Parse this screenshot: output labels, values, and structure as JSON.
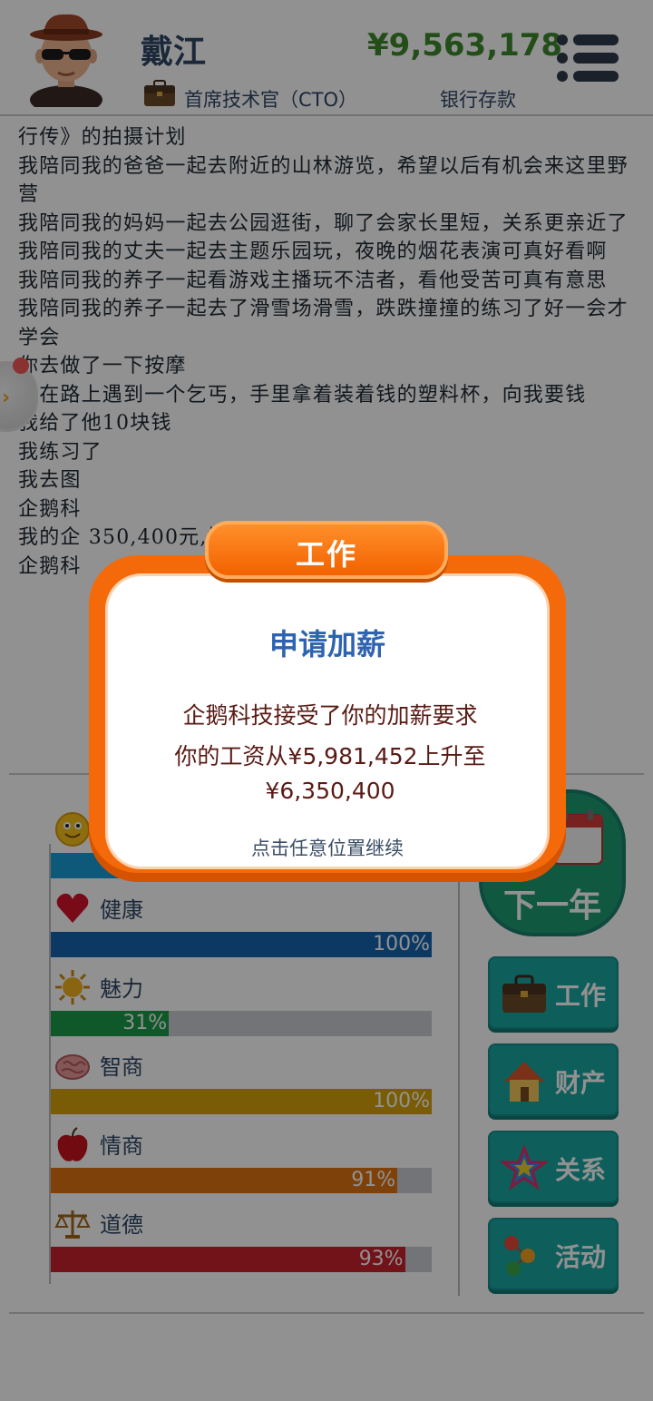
{
  "header": {
    "name": "戴江",
    "money": "¥9,563,178",
    "job_title": "首席技术官（CTO）",
    "bank_label": "银行存款"
  },
  "log": [
    "行传》的拍摄计划",
    "我陪同我的爸爸一起去附近的山林游览，希望以后有机会来这里野营",
    "我陪同我的妈妈一起去公园逛街，聊了会家长里短，关系更亲近了",
    "我陪同我的丈夫一起去主题乐园玩，夜晚的烟花表演可真好看啊",
    "我陪同我的养子一起看游戏主播玩不洁者，看他受苦可真有意思",
    "我陪同我的养子一起去了滑雪场滑雪，跌跌撞撞的练习了好一会才学会",
    "你去做了一下按摩",
    "我在路上遇到一个乞丐，手里拿着装着钱的塑料杯，向我要钱",
    "我给了他10块钱",
    "我练习了",
    "我去图",
    "企鹅科",
    "我的企                                                              350,400元,增加",
    "企鹅科"
  ],
  "stats": [
    {
      "label": "",
      "percent": 100,
      "color": "#1a9bd7"
    },
    {
      "label": "健康",
      "percent": 100,
      "color": "#1565b0"
    },
    {
      "label": "魅力",
      "percent": 31,
      "color": "#1c9c48"
    },
    {
      "label": "智商",
      "percent": 100,
      "color": "#d7a30e"
    },
    {
      "label": "情商",
      "percent": 91,
      "color": "#dd7210"
    },
    {
      "label": "道德",
      "percent": 93,
      "color": "#c8202c"
    }
  ],
  "stat_pct_labels": [
    "",
    "100%",
    "31%",
    "100%",
    "91%",
    "93%"
  ],
  "buttons": {
    "next_year": "下一年",
    "work": "工作",
    "property": "财产",
    "relations": "关系",
    "activities": "活动"
  },
  "dialog": {
    "tab_label": "工作",
    "title": "申请加薪",
    "message": "企鹅科技接受了你的加薪要求",
    "detail": "你的工资从¥5,981,452上升至¥6,350,400",
    "hint": "点击任意位置继续"
  },
  "colors": {
    "money": "#3f8a2c",
    "accent_orange": "#f46a0a",
    "button_teal": "#1aa6a1",
    "next_year_green": "#1f9b72",
    "title_blue": "#2d63b0"
  }
}
